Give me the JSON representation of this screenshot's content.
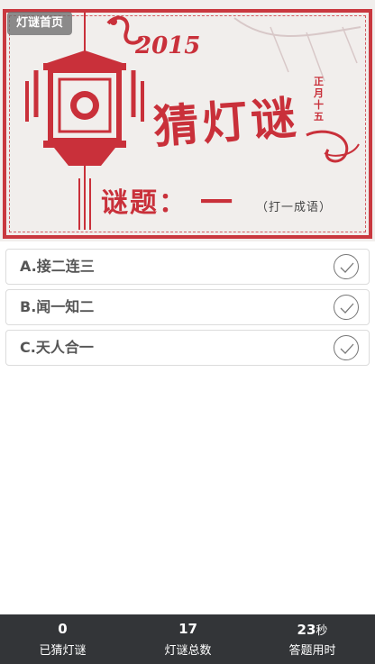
{
  "nav": {
    "home_label": "灯谜首页"
  },
  "banner": {
    "year": "2015",
    "title": "猜灯谜",
    "side_text": "正月十五",
    "question_label": "谜题：",
    "riddle": "一",
    "hint": "（打一成语）",
    "accent_color": "#c9303a"
  },
  "options": [
    {
      "label": "A.接二连三",
      "icon": "check-icon"
    },
    {
      "label": "B.闻一知二",
      "icon": "check-icon"
    },
    {
      "label": "C.天人合一",
      "icon": "check-icon"
    }
  ],
  "footer": {
    "guessed": {
      "value": "0",
      "label": "已猜灯谜"
    },
    "total": {
      "value": "17",
      "label": "灯谜总数"
    },
    "time": {
      "value": "23",
      "unit": "秒",
      "label": "答题用时"
    }
  }
}
